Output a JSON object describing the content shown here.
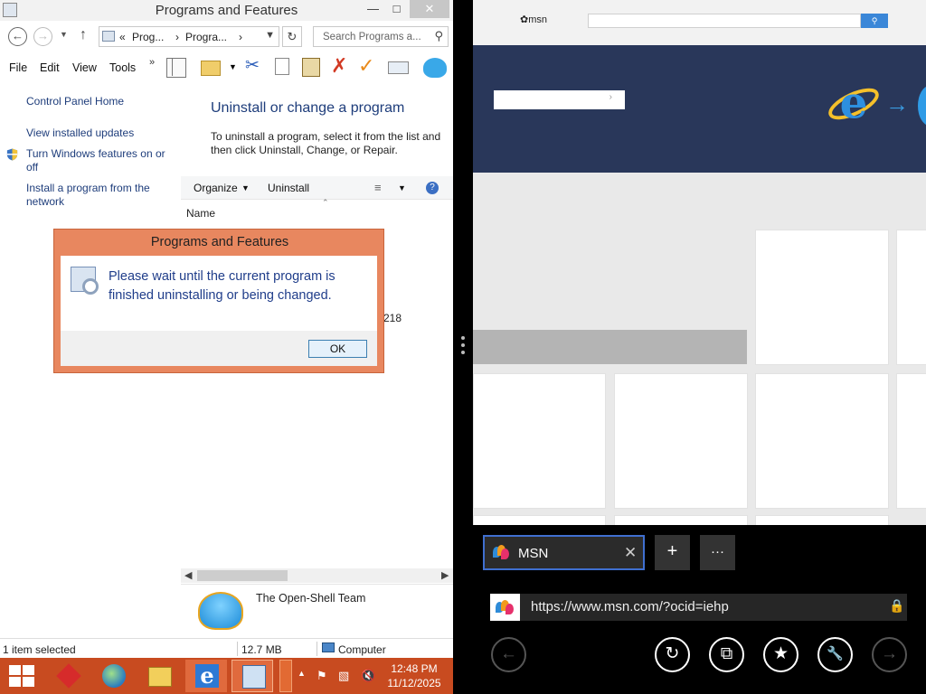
{
  "explorer": {
    "title": "Programs and Features",
    "window_controls": {
      "minimize": "—",
      "maximize": "□",
      "close": "✕"
    },
    "nav": {
      "back": "←",
      "forward": "→",
      "dropdown": "▼",
      "up": "↑",
      "refresh": "↻"
    },
    "breadcrumb": {
      "overflow": "«",
      "items": [
        "Prog...",
        "Progra..."
      ],
      "separator": "›"
    },
    "search": {
      "placeholder": "Search Programs a..."
    },
    "menu": [
      "File",
      "Edit",
      "View",
      "Tools"
    ],
    "menu_overflow": "»",
    "toolbar_icons": [
      "layout-icon",
      "folder-options-icon",
      "cut-icon",
      "copy-icon",
      "paste-icon",
      "delete-icon",
      "checkmark-icon",
      "properties-icon",
      "open-shell-icon"
    ],
    "sidebar": {
      "home": "Control Panel Home",
      "links": [
        "View installed updates",
        "Turn Windows features on or off",
        "Install a program from the network"
      ]
    },
    "main": {
      "heading": "Uninstall or change a program",
      "description": "To uninstall a program, select it from the list and then click Uninstall, Change, or Repair.",
      "commands": [
        "Organize",
        "Uninstall"
      ],
      "organize_caret": "▼",
      "view_caret": "▼",
      "help": "?",
      "column_header": "Name",
      "partial_row_text": "218"
    },
    "details": {
      "publisher": "The Open-Shell Team"
    },
    "status": {
      "selected": "1 item selected",
      "size": "12.7 MB",
      "location": "Computer"
    }
  },
  "dialog": {
    "title": "Programs and Features",
    "message": "Please wait until the current program is finished uninstalling or being changed.",
    "ok_label": "OK"
  },
  "taskbar": {
    "clock_time": "12:48 PM",
    "clock_date": "11/12/2025",
    "apps": [
      "red-app-icon",
      "globe-app-icon",
      "file-explorer-icon",
      "internet-explorer-icon",
      "control-panel-icon"
    ]
  },
  "browser": {
    "msn_logo_text": "msn",
    "hero_arrow": "→",
    "hero_input_chevron": "›",
    "tab_title": "MSN",
    "tab_close": "✕",
    "new_tab": "+",
    "tab_more": "···",
    "url": "https://www.msn.com/?ocid=iehp",
    "buttons": {
      "back": "←",
      "refresh": "↻",
      "tabs": "⧉",
      "favorites": "★",
      "tools": "🔧",
      "forward": "→"
    }
  },
  "colors": {
    "taskbar": "#c84b20",
    "dialog_frame": "#e8875f",
    "link": "#1e3d7b",
    "msn_hero": "#29375a",
    "tab_border": "#3f6fd0"
  }
}
